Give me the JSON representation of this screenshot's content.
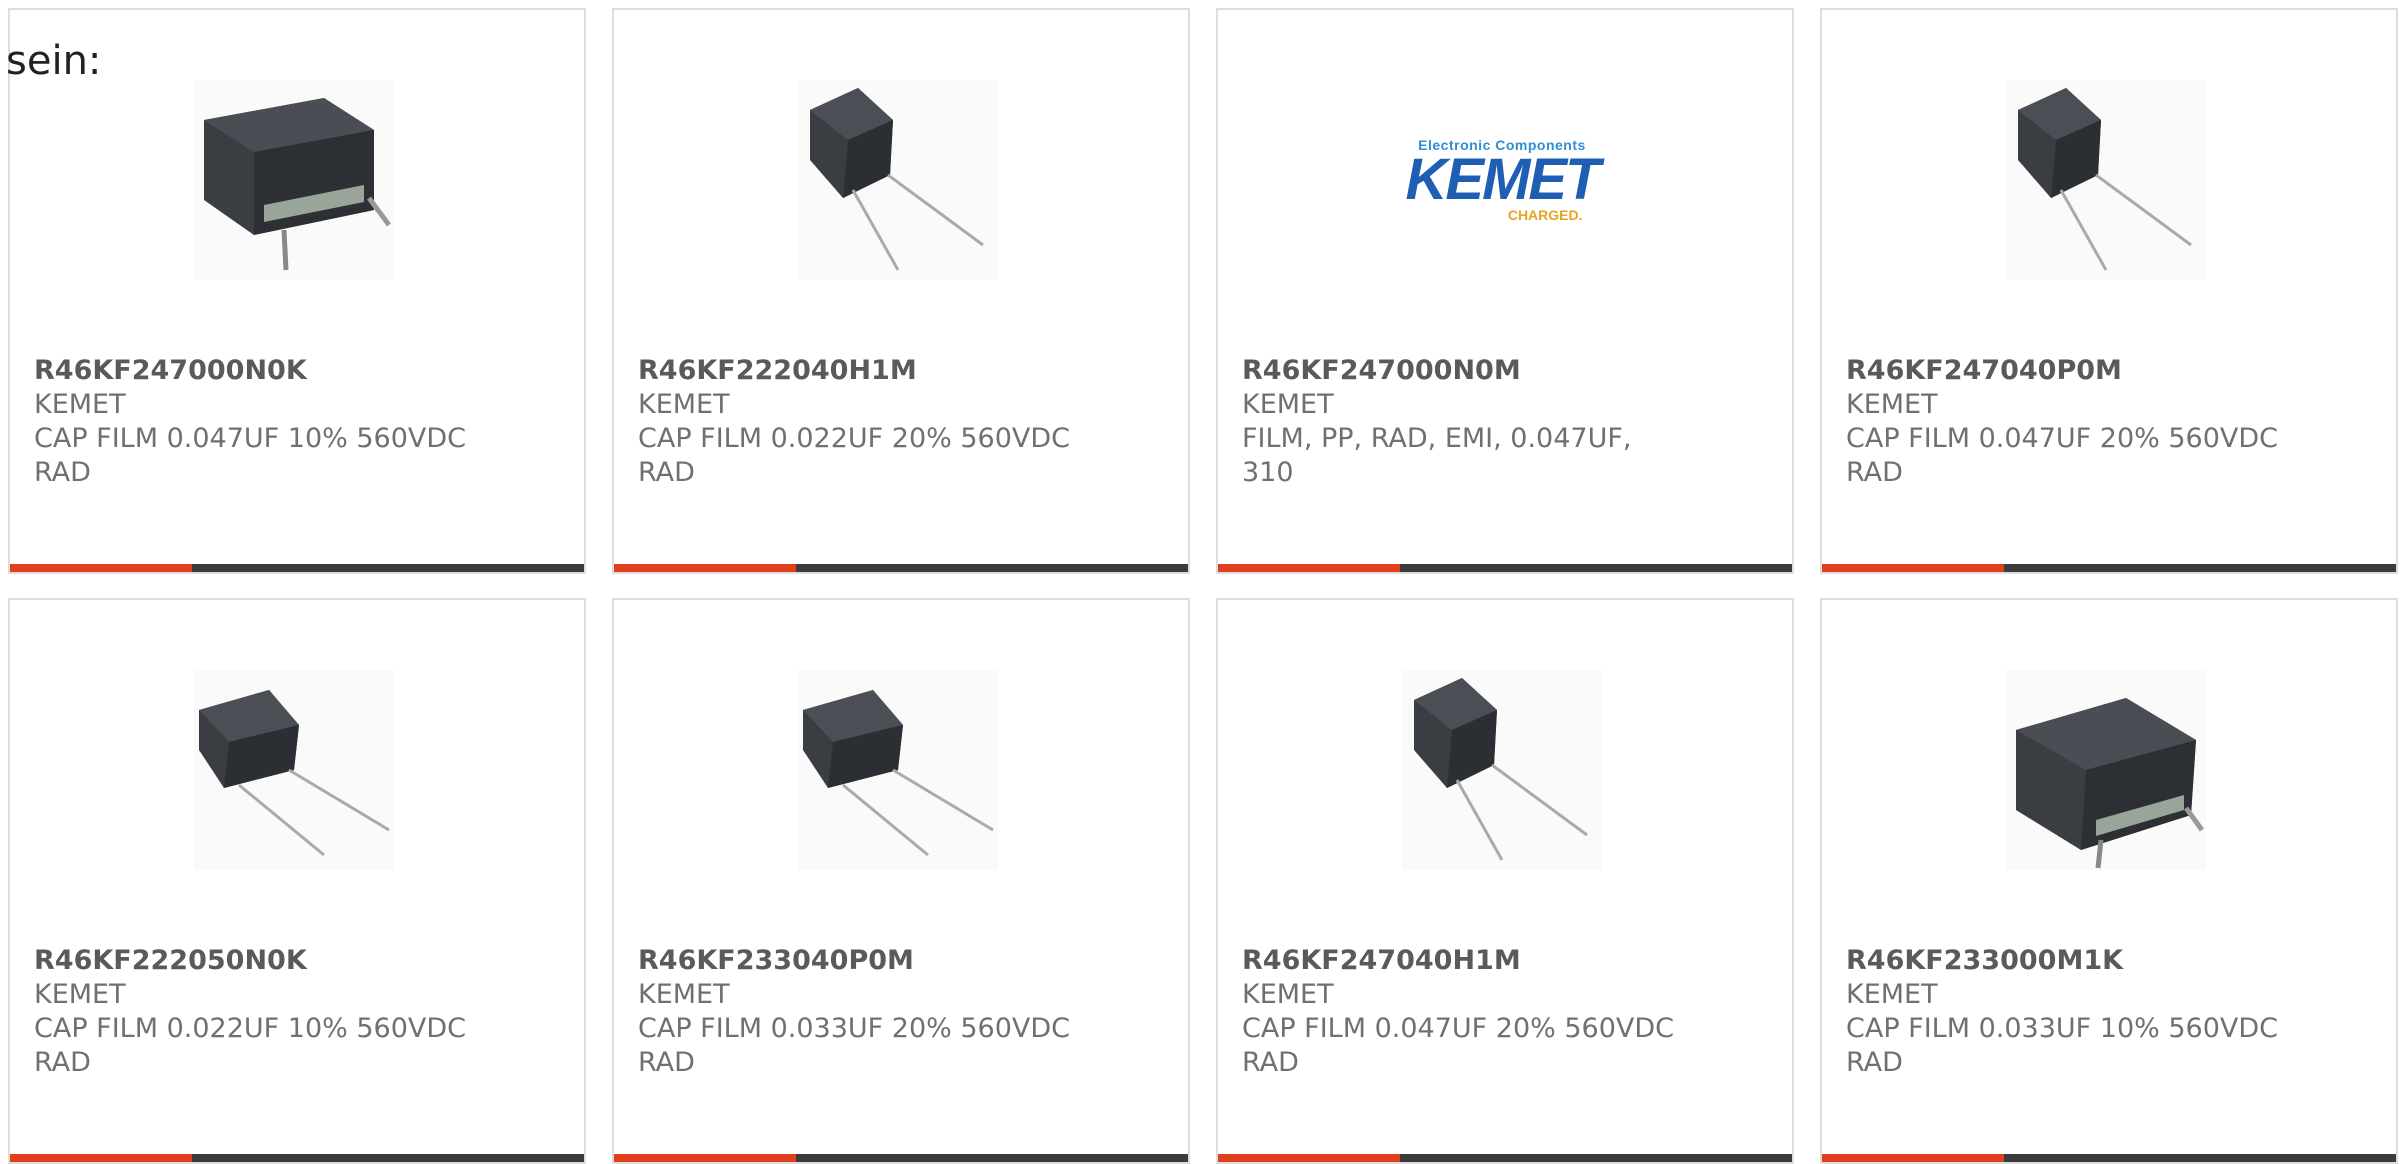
{
  "intro_text": "sein:",
  "colors": {
    "accent": "#e0401c",
    "bar": "#3c3c3c",
    "border": "#dddddd",
    "text": "#707070"
  },
  "products": [
    {
      "part_number": "R46KF247000N0K",
      "manufacturer": "KEMET",
      "desc_line1": "CAP FILM 0.047UF 10% 560VDC",
      "desc_line2": "RAD",
      "image": "capacitor-box-short-leads"
    },
    {
      "part_number": "R46KF222040H1M",
      "manufacturer": "KEMET",
      "desc_line1": "CAP FILM 0.022UF 20% 560VDC",
      "desc_line2": "RAD",
      "image": "capacitor-small-long-leads"
    },
    {
      "part_number": "R46KF247000N0M",
      "manufacturer": "KEMET",
      "desc_line1": "FILM, PP, RAD, EMI, 0.047UF,",
      "desc_line2": "310",
      "image": "kemet-logo",
      "logo": {
        "sub": "Electronic Components",
        "main": "KEMET",
        "tag": "CHARGED."
      }
    },
    {
      "part_number": "R46KF247040P0M",
      "manufacturer": "KEMET",
      "desc_line1": "CAP FILM 0.047UF 20% 560VDC",
      "desc_line2": "RAD",
      "image": "capacitor-small-long-leads"
    },
    {
      "part_number": "R46KF222050N0K",
      "manufacturer": "KEMET",
      "desc_line1": "CAP FILM 0.022UF 10% 560VDC",
      "desc_line2": "RAD",
      "image": "capacitor-flat-long-leads"
    },
    {
      "part_number": "R46KF233040P0M",
      "manufacturer": "KEMET",
      "desc_line1": "CAP FILM 0.033UF 20% 560VDC",
      "desc_line2": "RAD",
      "image": "capacitor-flat-long-leads"
    },
    {
      "part_number": "R46KF247040H1M",
      "manufacturer": "KEMET",
      "desc_line1": "CAP FILM 0.047UF 20% 560VDC",
      "desc_line2": "RAD",
      "image": "capacitor-small-long-leads"
    },
    {
      "part_number": "R46KF233000M1K",
      "manufacturer": "KEMET",
      "desc_line1": "CAP FILM 0.033UF 10% 560VDC",
      "desc_line2": "RAD",
      "image": "capacitor-box-short-leads"
    }
  ]
}
